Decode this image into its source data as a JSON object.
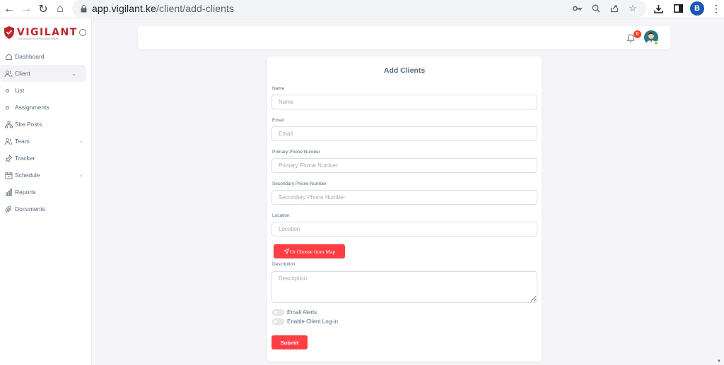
{
  "browser": {
    "url_host": "app.vigilant.ke",
    "url_path": "/client/add-clients",
    "profile_initial": "B"
  },
  "sidebar": {
    "brand": "VIGILANT",
    "brand_tagline": "SAFEGUARD YOUR VALUABLE ASSETS",
    "items": [
      {
        "label": "Dashboard",
        "icon": "home-icon"
      },
      {
        "label": "Client",
        "icon": "users-icon",
        "expanded": true
      },
      {
        "label": "List",
        "icon": "circle-icon"
      },
      {
        "label": "Assignments",
        "icon": "circle-icon"
      },
      {
        "label": "Site Posts",
        "icon": "sitemap-icon"
      },
      {
        "label": "Team",
        "icon": "users-icon"
      },
      {
        "label": "Tracker",
        "icon": "pin-icon"
      },
      {
        "label": "Schedule",
        "icon": "calendar-icon"
      },
      {
        "label": "Reports",
        "icon": "chart-icon"
      },
      {
        "label": "Documents",
        "icon": "paperclip-icon"
      }
    ]
  },
  "topbar": {
    "notification_count": "0"
  },
  "form": {
    "title": "Add Clients",
    "name_label": "Name",
    "name_placeholder": "Name",
    "email_label": "Email",
    "email_placeholder": "Email",
    "primary_phone_label": "Primary Phone Number",
    "primary_phone_placeholder": "Primary Phone Number",
    "secondary_phone_label": "Secondary Phone Number",
    "secondary_phone_placeholder": "Secondary Phone Number",
    "location_label": "Location",
    "location_placeholder": "Location",
    "map_button": "Or Choose from Map",
    "description_label": "Description",
    "description_placeholder": "Description",
    "email_alerts_label": "Email Alerts",
    "email_alerts_on": false,
    "client_login_label": "Enable Client Log-in",
    "client_login_on": false,
    "submit_label": "Submit"
  },
  "colors": {
    "accent": "#ff3e44",
    "brand": "#c0252b",
    "background": "#f5f5f9"
  }
}
